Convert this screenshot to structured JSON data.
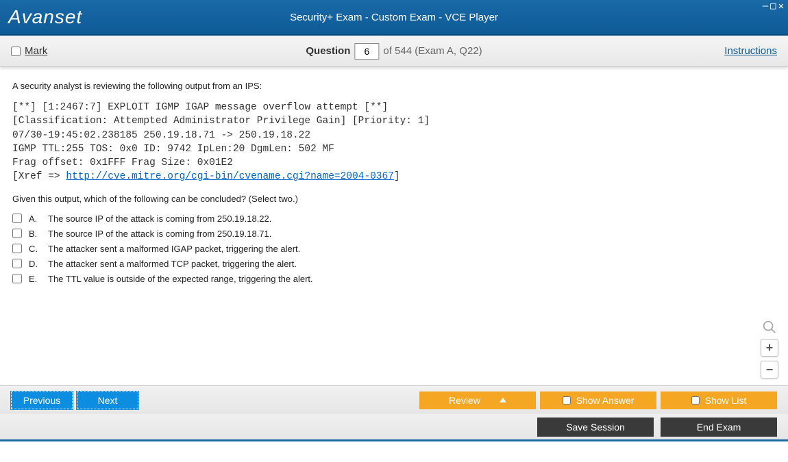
{
  "window": {
    "logo": "Avanset",
    "title": "Security+ Exam - Custom Exam - VCE Player"
  },
  "topbar": {
    "mark_label": "Mark",
    "question_word": "Question",
    "question_num": "6",
    "question_rest": "of 544 (Exam A, Q22)",
    "instructions": "Instructions"
  },
  "question": {
    "intro": "A security analyst is reviewing the following output from an IPS:",
    "code_line1": "[**] [1:2467:7] EXPLOIT IGMP IGAP message overflow attempt [**]",
    "code_line2": "[Classification: Attempted Administrator Privilege Gain] [Priority: 1]",
    "code_line3": "07/30-19:45:02.238185 250.19.18.71 -> 250.19.18.22",
    "code_line4": "IGMP TTL:255 TOS: 0x0 ID: 9742 IpLen:20 DgmLen: 502 MF",
    "code_line5": "Frag offset: 0x1FFF Frag Size: 0x01E2",
    "code_xref_pre": "[Xref => ",
    "code_xref_link": "http://cve.mitre.org/cgi-bin/cvename.cgi?name=2004-0367",
    "code_xref_post": "]",
    "sub": "Given this output, which of the following can be concluded? (Select two.)",
    "answers": [
      {
        "letter": "A.",
        "text": "The source IP of the attack is coming from 250.19.18.22."
      },
      {
        "letter": "B.",
        "text": "The source IP of the attack is coming from 250.19.18.71."
      },
      {
        "letter": "C.",
        "text": "The attacker sent a malformed IGAP packet, triggering the alert."
      },
      {
        "letter": "D.",
        "text": "The attacker sent a malformed TCP packet, triggering the alert."
      },
      {
        "letter": "E.",
        "text": "The TTL value is outside of the expected range, triggering the alert."
      }
    ]
  },
  "footer": {
    "previous": "Previous",
    "next": "Next",
    "review": "Review",
    "show_answer": "Show Answer",
    "show_list": "Show List",
    "save_session": "Save Session",
    "end_exam": "End Exam"
  }
}
